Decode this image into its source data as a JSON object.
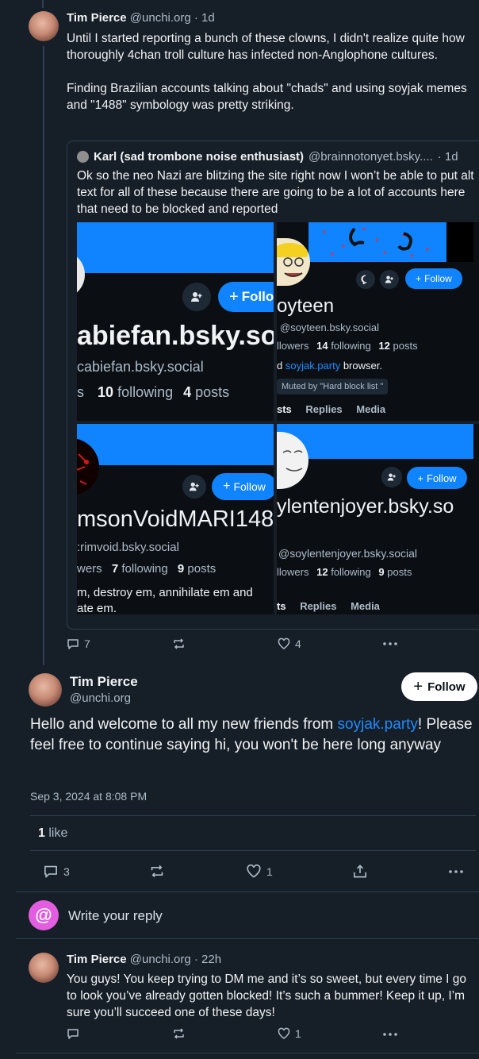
{
  "post1": {
    "author_name": "Tim Pierce",
    "author_handle": "@unchi.org",
    "time": "· 1d",
    "text": "Until I started reporting a bunch of these clowns, I didn't realize quite how thoroughly 4chan troll culture has infected non-Anglophone cultures.\n\nFinding Brazilian accounts talking about \"chads\" and using soyjak memes and \"1488\" symbology was pretty striking.",
    "replies": "7",
    "reposts": "",
    "likes": "4"
  },
  "quote": {
    "author_name": "Karl (sad trombone noise enthusiast)",
    "author_handle": "@brainnotonyet.bsky....",
    "time": "· 1d",
    "text": "Ok so the neo Nazi are blitzing the site right now I won’t be able to put alt text for all of these because there are going to be a lot of accounts here that need to be blocked and reported",
    "img1": {
      "follow_label": "Follo",
      "handle_big": "abiefan.bsky.so",
      "handle_small": "cabiefan.bsky.social",
      "stats_prefix": "s",
      "following_count": "10",
      "following_label": "following",
      "posts_count": "4",
      "posts_label": "posts"
    },
    "img2": {
      "follow_label": "Follow",
      "name": "oyteen",
      "handle": "@soyteen.bsky.social",
      "followers_label": "llowers",
      "following_count": "14",
      "following_label": "following",
      "posts_count": "12",
      "posts_label": "posts",
      "bio_prefix": "d ",
      "bio_link": "soyjak.party",
      "bio_suffix": " browser.",
      "muted_label": "Muted by \"Hard block list \"",
      "tabs": [
        "sts",
        "Replies",
        "Media"
      ]
    },
    "img3": {
      "follow_label": "Follow",
      "name": "msonVoidMARI148",
      "handle": ":rimvoid.bsky.social",
      "followers_label": "wers",
      "following_count": "7",
      "following_label": "following",
      "posts_count": "9",
      "posts_label": "posts",
      "bio_line1": "m, destroy em, annihilate em and",
      "bio_line2": "ate em."
    },
    "img4": {
      "follow_label": "Follow",
      "handle_big": "ylentenjoyer.bsky.so",
      "handle": "@soylentenjoyer.bsky.social",
      "followers_label": "llowers",
      "following_count": "12",
      "following_label": "following",
      "posts_count": "9",
      "posts_label": "posts",
      "tabs": [
        "ts",
        "Replies",
        "Media"
      ]
    }
  },
  "main_post": {
    "author_name": "Tim Pierce",
    "author_handle": "@unchi.org",
    "follow_label": "Follow",
    "text_before": "Hello and welcome to all my new friends from ",
    "text_link": "soyjak.party",
    "text_after": "! Please feel free to continue saying hi, you won't be here long anyway",
    "timestamp": "Sep 3, 2024 at 8:08 PM",
    "like_count": "1",
    "like_label": "like",
    "replies": "3",
    "likes": "1"
  },
  "composer": {
    "placeholder": "Write your reply"
  },
  "reply": {
    "author_name": "Tim Pierce",
    "author_handle": "@unchi.org",
    "time": "· 22h",
    "text": "You guys! You keep trying to DM me and it’s so sweet, but every time I go to look you’ve already gotten blocked! It’s such a bummer! Keep it up, I’m sure you’ll succeed one of these days!",
    "likes": "1"
  },
  "colors": {
    "background": "#161e27",
    "accent": "#208bfe",
    "muted": "#aebbc9",
    "composer_avatar": "#e35de0"
  }
}
